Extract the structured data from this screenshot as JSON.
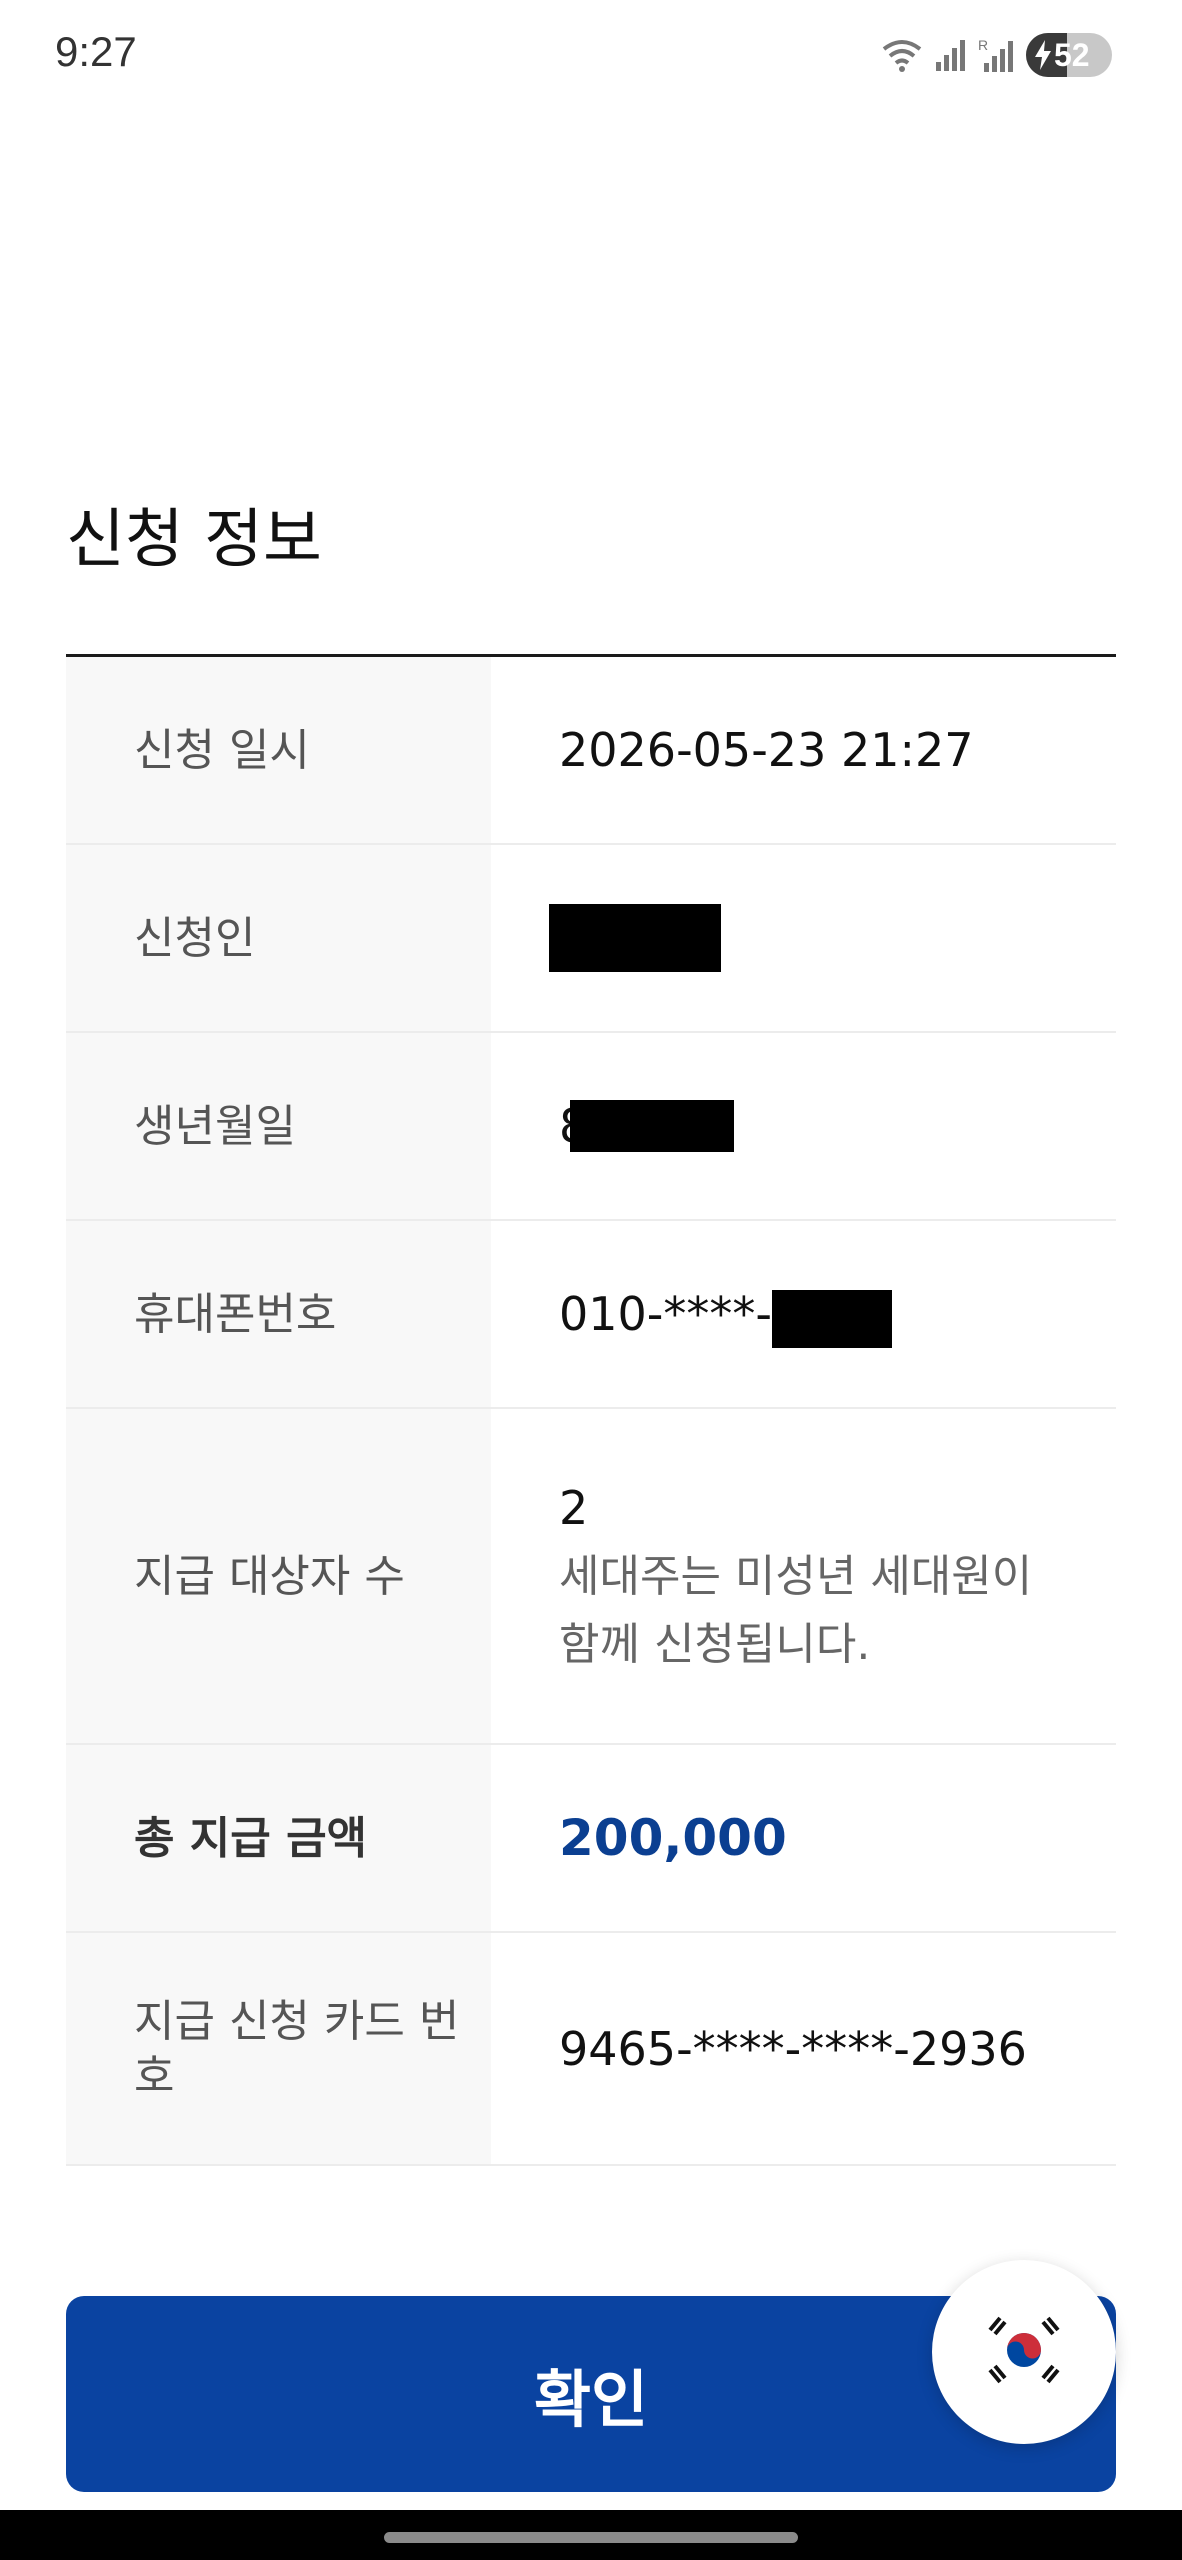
{
  "status_bar": {
    "time": "9:27",
    "battery_level": "52",
    "icons": [
      "wifi-icon",
      "signal-icon",
      "signal-roaming-icon",
      "battery-charging-icon"
    ]
  },
  "page": {
    "title": "신청 정보"
  },
  "info_table": {
    "rows": [
      {
        "label": "신청 일시",
        "value": "2026-05-23 21:27"
      },
      {
        "label": "신청인",
        "value": ""
      },
      {
        "label": "생년월일",
        "value": "8"
      },
      {
        "label": "휴대폰번호",
        "value": "010-****-"
      },
      {
        "label": "지급 대상자 수",
        "value": "2",
        "note": "세대주는 미성년 세대원이 함께 신청됩니다."
      },
      {
        "label": "총 지급 금액",
        "value": "200,000"
      },
      {
        "label": "지급 신청 카드 번호",
        "value": "9465-****-****-2936"
      }
    ]
  },
  "confirm_button": {
    "label": "확인"
  },
  "floating": {
    "icon": "korea-flag-icon"
  },
  "colors": {
    "primary": "#0a43a1",
    "amount": "#0b3f91",
    "label_bg": "#f8f8f8"
  }
}
